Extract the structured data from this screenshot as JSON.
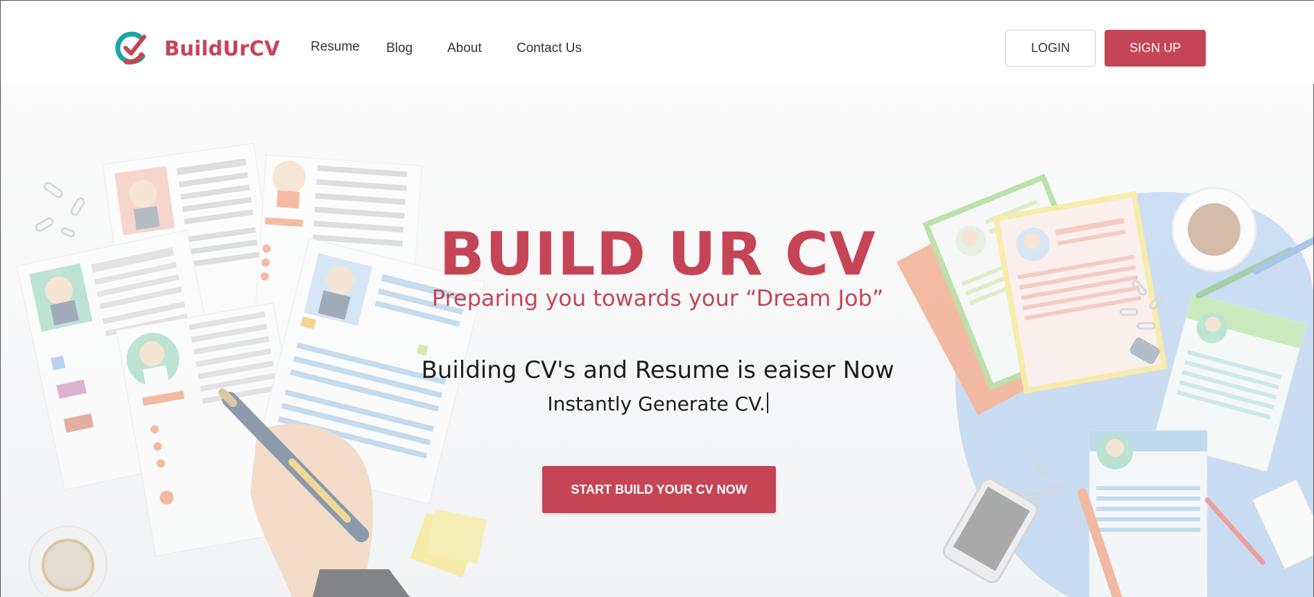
{
  "brand": {
    "name": "BuildUrCV",
    "accent": "#c54556",
    "teal": "#1aa6a6"
  },
  "nav": {
    "items": [
      {
        "label": "Resume"
      },
      {
        "label": "Blog"
      },
      {
        "label": "About"
      },
      {
        "label": "Contact Us"
      }
    ]
  },
  "auth": {
    "login_label": "LOGIN",
    "signup_label": "SIGN UP"
  },
  "hero": {
    "title": "BUILD UR CV",
    "subtitle": "Preparing you towards your “Dream Job”",
    "line1": "Building CV's and Resume is eaiser Now",
    "line2": "Instantly Generate CV.",
    "cta_label": "START BUILD YOUR CV NOW"
  },
  "icons": [
    "logo-check-icon"
  ]
}
